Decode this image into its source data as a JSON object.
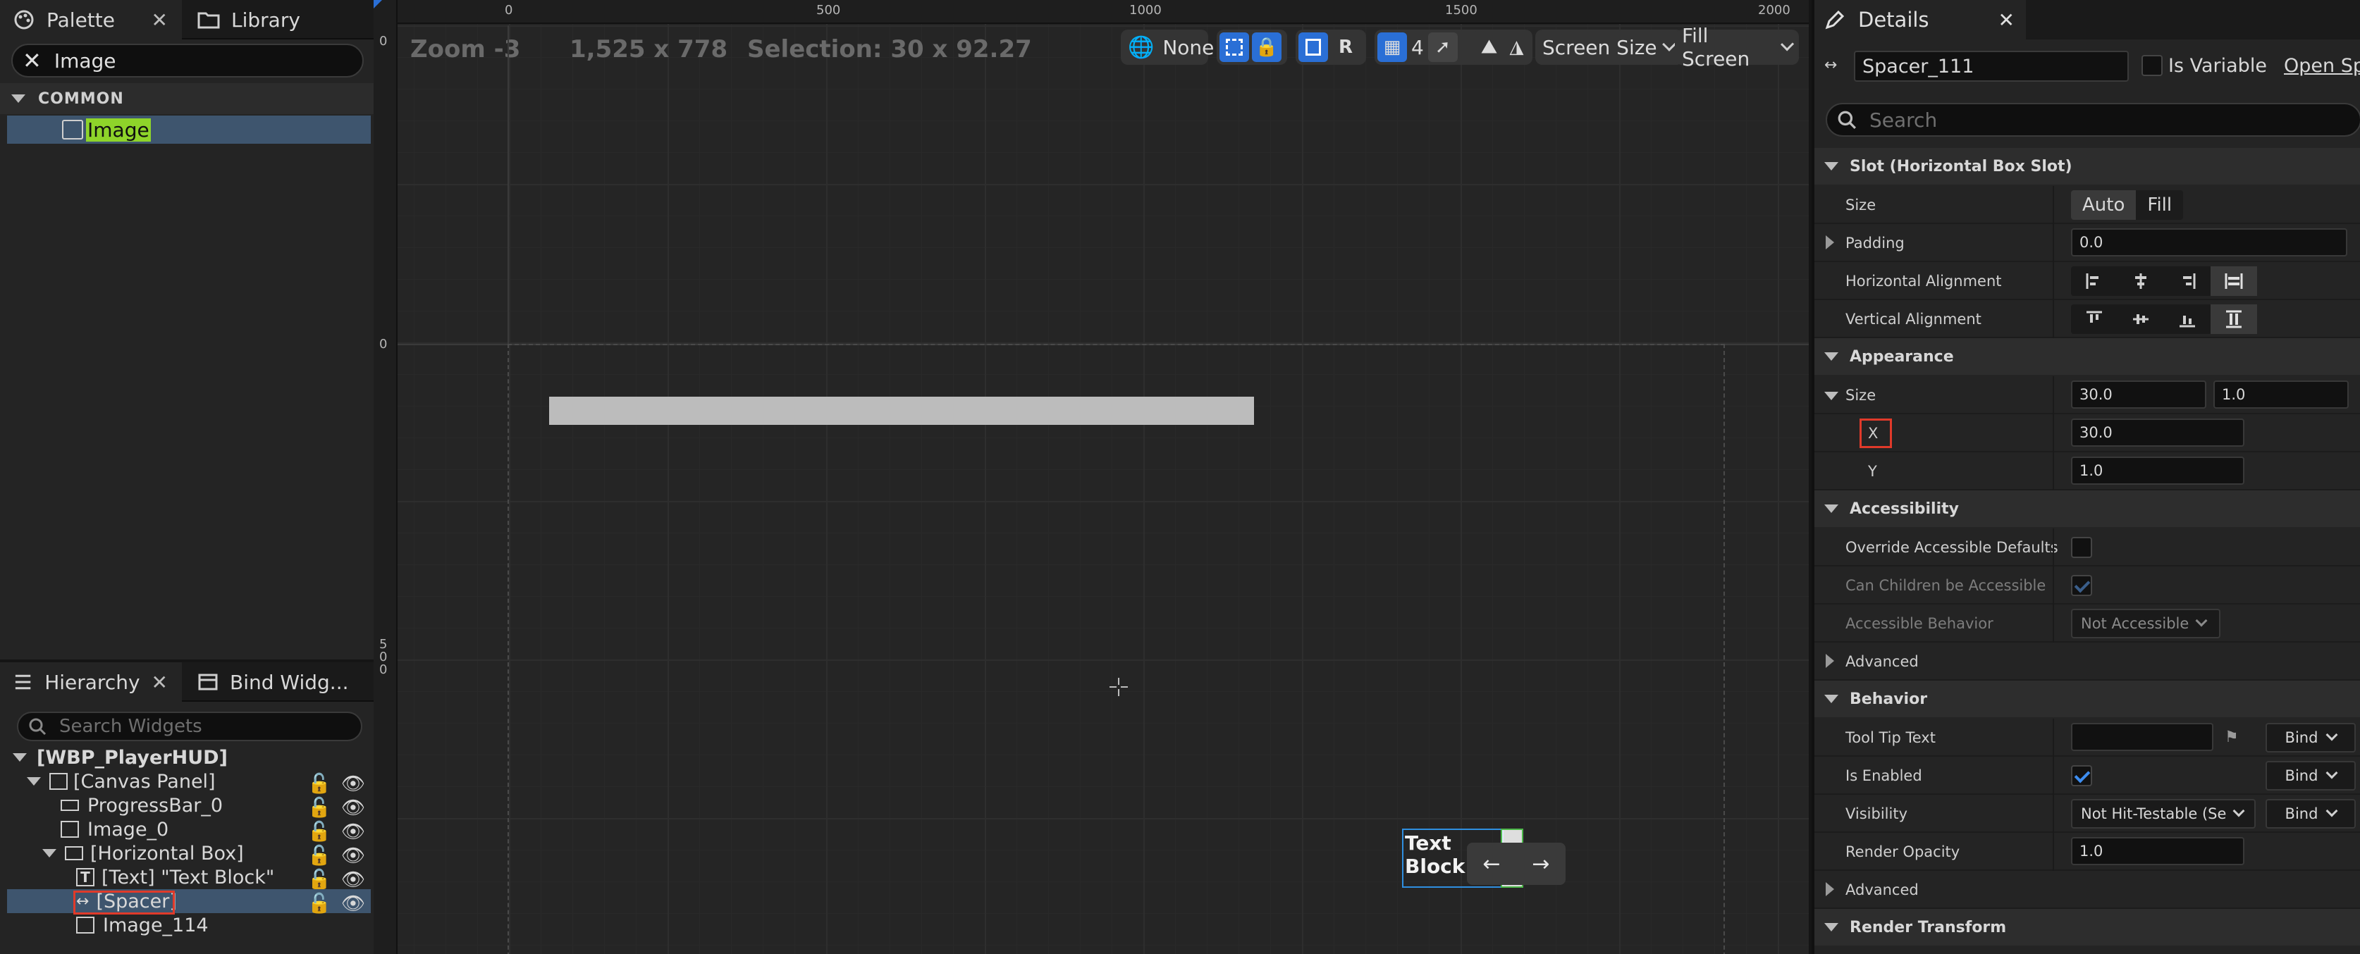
{
  "palette": {
    "tab_label": "Palette",
    "library_label": "Library",
    "search_value": "Image",
    "category": "COMMON",
    "item": "Image"
  },
  "hierarchy": {
    "tab_label": "Hierarchy",
    "bind_tab_label": "Bind Widg...",
    "search_placeholder": "Search Widgets",
    "nodes": [
      "[WBP_PlayerHUD]",
      "[Canvas Panel]",
      "ProgressBar_0",
      "Image_0",
      "[Horizontal Box]",
      "[Text] \"Text Block\"",
      "[Spacer]",
      "Image_114"
    ]
  },
  "viewport": {
    "zoom": "Zoom -3",
    "resolution": "1,525 x 778",
    "selection": "Selection: 30 x 92.27",
    "ruler_top": [
      "0",
      "500",
      "1000",
      "1500",
      "2000"
    ],
    "ruler_left_top": "0",
    "ruler_left_mid": "0",
    "ruler_left_500": "5\n0\n0",
    "toolbar": {
      "none_label": "None",
      "r_label": "R",
      "grid_value": "4",
      "screen_size": "Screen Size",
      "fill_screen": "Fill Screen"
    },
    "text_block": "Text Block",
    "nudge_left": "←",
    "nudge_right": "→"
  },
  "details": {
    "tab_label": "Details",
    "name_value": "Spacer_111",
    "is_variable_label": "Is Variable",
    "open_label": "Open Spa",
    "search_placeholder": "Search",
    "sections": {
      "slot": "Slot (Horizontal Box Slot)",
      "appearance": "Appearance",
      "accessibility": "Accessibility",
      "behavior": "Behavior",
      "render_transform": "Render Transform"
    },
    "props": {
      "size": "Size",
      "size_auto": "Auto",
      "size_fill": "Fill",
      "padding": "Padding",
      "padding_value": "0.0",
      "h_align": "Horizontal Alignment",
      "v_align": "Vertical Alignment",
      "app_size": "Size",
      "app_size_x": "30.0",
      "app_size_y": "1.0",
      "x_label": "X",
      "x_value": "30.0",
      "y_label": "Y",
      "y_value": "1.0",
      "override_acc": "Override Accessible Defaults",
      "can_children": "Can Children be Accessible",
      "acc_behavior": "Accessible Behavior",
      "acc_behavior_value": "Not Accessible",
      "advanced": "Advanced",
      "tooltip": "Tool Tip Text",
      "is_enabled": "Is Enabled",
      "visibility": "Visibility",
      "visibility_value": "Not Hit-Testable (Se",
      "render_opacity": "Render Opacity",
      "render_opacity_value": "1.0",
      "bind": "Bind",
      "advanced2": "Advanced"
    }
  }
}
